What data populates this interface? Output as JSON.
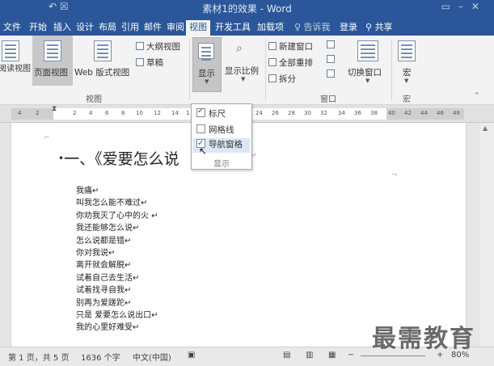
{
  "window": {
    "title": "素材1的效果 - Word",
    "quick_access": "↶  ☒"
  },
  "tabs": [
    {
      "label": "文件"
    },
    {
      "label": "开始"
    },
    {
      "label": "插入"
    },
    {
      "label": "设计"
    },
    {
      "label": "布局"
    },
    {
      "label": "引用"
    },
    {
      "label": "邮件"
    },
    {
      "label": "审阅"
    },
    {
      "label": "视图"
    },
    {
      "label": "开发工具"
    },
    {
      "label": "加载项"
    },
    {
      "label": "♀ 告诉我"
    },
    {
      "label": "登录"
    },
    {
      "label": "共享"
    }
  ],
  "active_tab": "视图",
  "ribbon": {
    "views": {
      "read_mode": "阅读视图",
      "print_layout": "页面视图",
      "web_layout": "Web 版式视图",
      "outline": "大纲视图",
      "draft": "草稿",
      "group": "视图"
    },
    "show": {
      "label": "显示"
    },
    "zoom": {
      "label": "显示比例"
    },
    "window": {
      "new_window": "新建窗口",
      "arrange_all": "全部重排",
      "split": "拆分",
      "switch_windows": "切换窗口",
      "group": "窗口"
    },
    "macros": {
      "label": "宏",
      "group": "宏"
    }
  },
  "ruler_ticks": [
    "4",
    "2",
    "2",
    "4",
    "6",
    "8",
    "10",
    "12",
    "14",
    "1",
    "24",
    "26",
    "28",
    "30",
    "32",
    "34",
    "36",
    "38",
    "40",
    "42",
    "44",
    "46",
    "48"
  ],
  "dropdown": {
    "items": [
      {
        "label": "标尺",
        "checked": true
      },
      {
        "label": "网格线",
        "checked": false
      },
      {
        "label": "导航窗格",
        "checked": true
      }
    ],
    "group_label": "显示"
  },
  "document": {
    "heading": "一、《爱要怎么说",
    "lines": [
      "我痛↵",
      "叫我怎么能不难过↵",
      "你劝我灭了心中的火 ↵",
      "我还能够怎么说↵",
      "怎么说都是错↵",
      "你对我说↵",
      "离开就会解脱↵",
      "试着自己去生活↵",
      "试着找寻自我↵",
      "别再为爱蹉跎↵",
      "只是 爱要怎么说出口↵",
      "我的心里好难受↵"
    ]
  },
  "status": {
    "page": "第 1 页，共 5 页",
    "words": "1636 个字",
    "language": "中文(中国)",
    "zoom": "80%"
  },
  "watermark": "最需教育"
}
